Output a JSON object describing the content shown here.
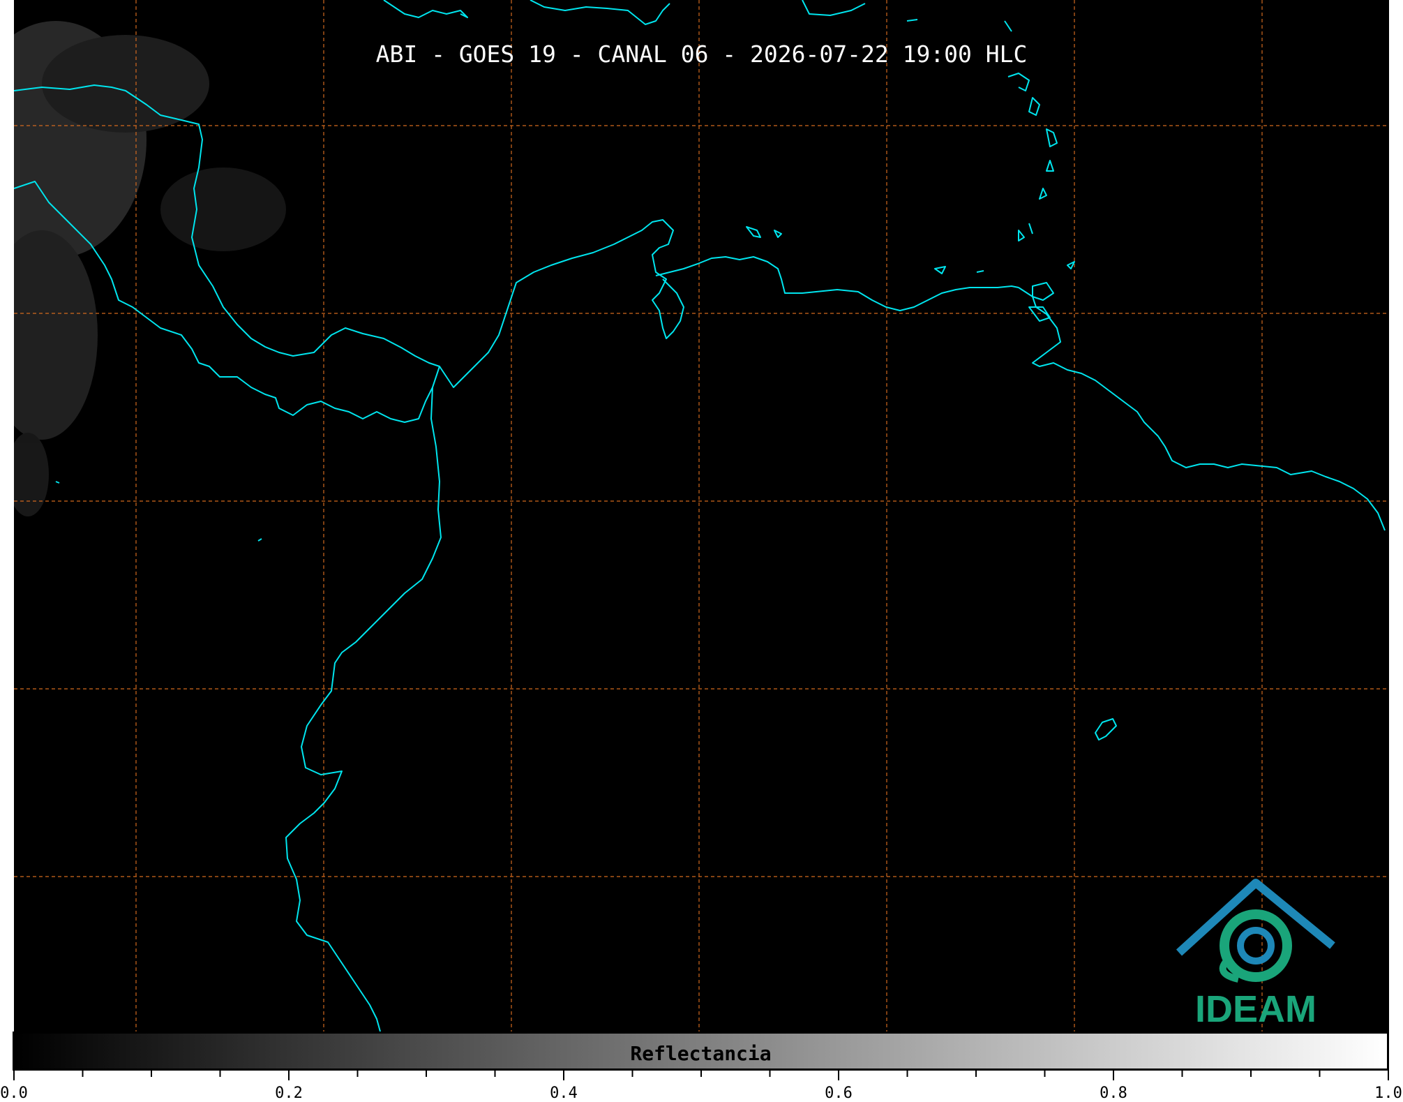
{
  "title": "ABI - GOES 19 - CANAL 06 - 2026-07-22 19:00 HLC",
  "colors": {
    "coastline": "#00e5ee",
    "graticule": "#d2691e",
    "background": "#000000",
    "logo_text": "#1aa57a",
    "logo_mark": "#1e88b8"
  },
  "colorbar": {
    "label": "Reflectancia",
    "range": [
      0.0,
      1.0
    ],
    "colormap": "grayscale",
    "tick_labels": [
      "0.0",
      "0.2",
      "0.4",
      "0.6",
      "0.8",
      "1.0"
    ]
  },
  "map": {
    "graticule": "dashed",
    "coastlines": "cyan"
  },
  "logo": {
    "text": "IDEAM",
    "icon": "ideam-logo-icon"
  }
}
